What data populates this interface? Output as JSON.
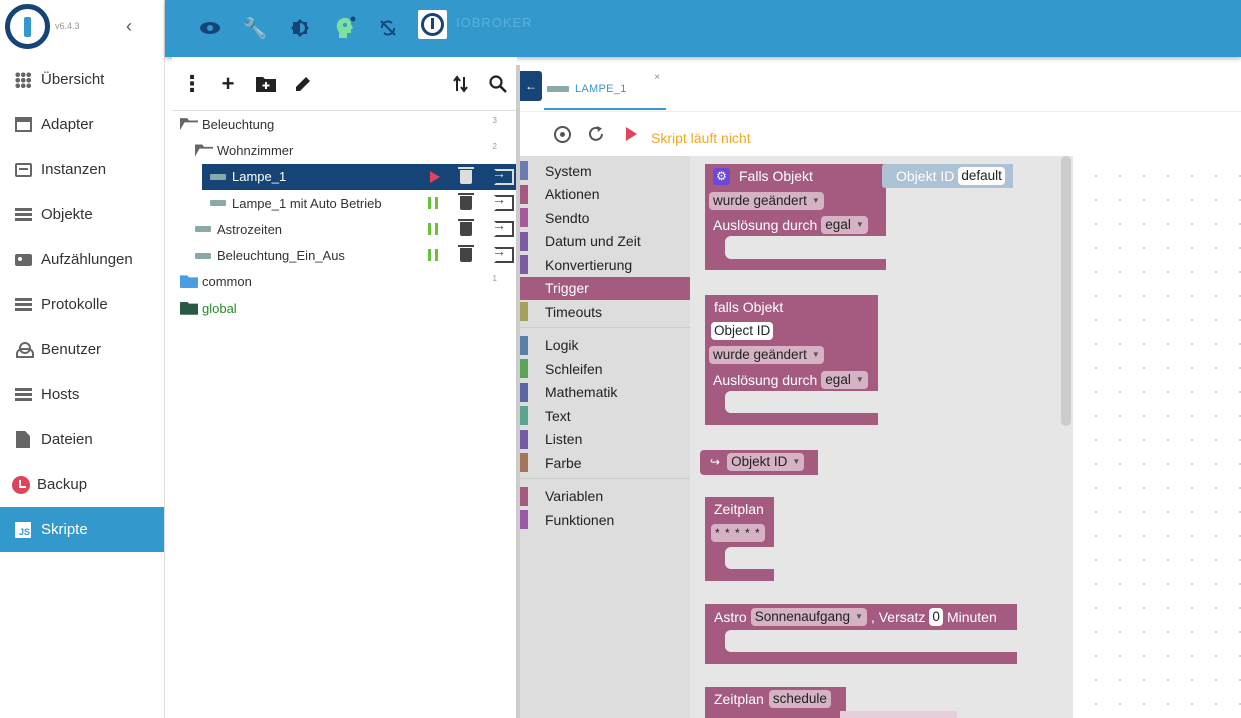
{
  "app": {
    "version": "v6.4.3",
    "brand": "IOBROKER"
  },
  "sidebar": {
    "items": [
      {
        "label": "Übersicht",
        "icon": "grid-icon"
      },
      {
        "label": "Adapter",
        "icon": "store-icon"
      },
      {
        "label": "Instanzen",
        "icon": "instances-icon"
      },
      {
        "label": "Objekte",
        "icon": "list-icon"
      },
      {
        "label": "Aufzählungen",
        "icon": "enum-icon"
      },
      {
        "label": "Protokolle",
        "icon": "log-icon"
      },
      {
        "label": "Benutzer",
        "icon": "user-icon"
      },
      {
        "label": "Hosts",
        "icon": "hosts-icon"
      },
      {
        "label": "Dateien",
        "icon": "files-icon"
      },
      {
        "label": "Backup",
        "icon": "backup-icon"
      },
      {
        "label": "Skripte",
        "icon": "js-icon",
        "active": true
      }
    ],
    "js_badge": "JS"
  },
  "topbar": {
    "icons": [
      "eye-icon",
      "wrench-icon",
      "theme-icon",
      "expert-icon",
      "sync-off-icon"
    ]
  },
  "tree": {
    "rows": [
      {
        "label": "Beleuchtung",
        "count": "3"
      },
      {
        "label": "Wohnzimmer",
        "count": "2"
      },
      {
        "label": "Lampe_1"
      },
      {
        "label": "Lampe_1 mit Auto Betrieb"
      },
      {
        "label": "Astrozeiten"
      },
      {
        "label": "Beleuchtung_Ein_Aus"
      },
      {
        "label": "common",
        "count": "1"
      },
      {
        "label": "global"
      }
    ]
  },
  "editor": {
    "tab_label": "LAMPE_1",
    "tab_close": "×",
    "status": "Skript läuft nicht"
  },
  "toolbox": {
    "categories": [
      {
        "label": "System",
        "color": "#6c7bb0"
      },
      {
        "label": "Aktionen",
        "color": "#a55b80"
      },
      {
        "label": "Sendto",
        "color": "#a55b9b"
      },
      {
        "label": "Datum und Zeit",
        "color": "#7c5ba5"
      },
      {
        "label": "Konvertierung",
        "color": "#7c5ba5"
      },
      {
        "label": "Trigger",
        "color": "#a55b80",
        "active": true
      },
      {
        "label": "Timeouts",
        "color": "#a5a05b"
      },
      {
        "label": "Logik",
        "color": "#5b80a5"
      },
      {
        "label": "Schleifen",
        "color": "#5ba55b"
      },
      {
        "label": "Mathematik",
        "color": "#5b67a5"
      },
      {
        "label": "Text",
        "color": "#5ba58c"
      },
      {
        "label": "Listen",
        "color": "#745ba5"
      },
      {
        "label": "Farbe",
        "color": "#a5745b"
      },
      {
        "label": "Variablen",
        "color": "#a55b80"
      },
      {
        "label": "Funktionen",
        "color": "#995ba5"
      }
    ]
  },
  "blocks": {
    "falls_objekt": {
      "title": "Falls Objekt",
      "changed": "wurde geändert",
      "trigger_label": "Auslösung durch",
      "trigger_value": "egal",
      "side_label": "Objekt ID",
      "side_value": "default"
    },
    "falls_objekt2": {
      "title": "falls Objekt",
      "object_id": "Object ID",
      "changed": "wurde geändert",
      "trigger_label": "Auslösung durch",
      "trigger_value": "egal"
    },
    "objekt_id": {
      "arrow": "↪",
      "value": "Objekt ID"
    },
    "zeitplan": {
      "title": "Zeitplan",
      "value": "* * * * *"
    },
    "astro": {
      "title": "Astro",
      "event": "Sonnenaufgang",
      "offset_label": ", Versatz",
      "offset": "0",
      "unit": "Minuten"
    },
    "zeitplan2": {
      "title": "Zeitplan",
      "value": "schedule"
    }
  }
}
